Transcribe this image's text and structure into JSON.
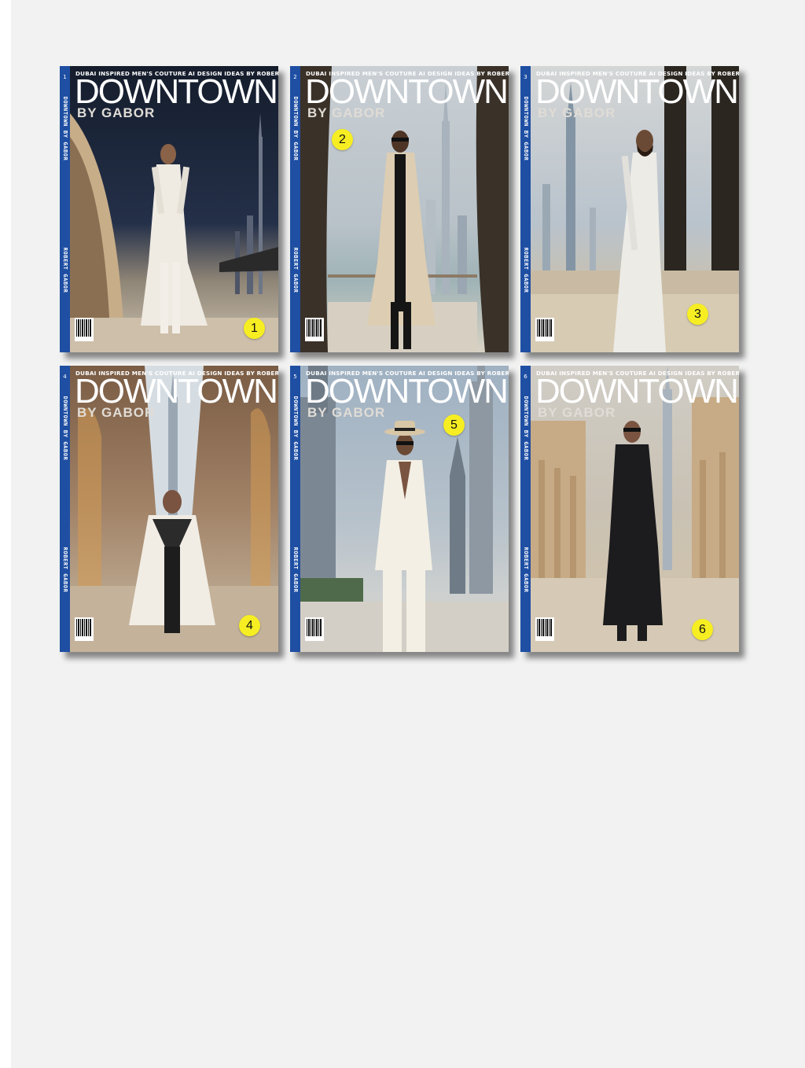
{
  "covers": [
    {
      "id": 1,
      "spine_number": "1",
      "spine_title": "DOWNTOWN BY GABOR",
      "spine_author": "ROBERT GABOR",
      "tagline": "DUBAI INSPIRED MEN'S COUTURE AI DESIGN IDEAS BY ROBERT GABOR",
      "masthead": "DOWNTOWN",
      "subhead": "BY GABOR",
      "badge": "1",
      "sky": "#1c2536",
      "ground": "#c8bca8",
      "outfit": "#efebe3"
    },
    {
      "id": 2,
      "spine_number": "2",
      "spine_title": "DOWNTOWN BY GABOR",
      "spine_author": "ROBERT GABOR",
      "tagline": "DUBAI INSPIRED MEN'S COUTURE AI DESIGN IDEAS BY ROBERT GABOR",
      "masthead": "DOWNTOWN",
      "subhead": "BY GABOR",
      "badge": "2",
      "sky": "#c6cdd3",
      "ground": "#d8d2c4",
      "outfit": "#ddcdb2"
    },
    {
      "id": 3,
      "spine_number": "3",
      "spine_title": "DOWNTOWN BY GABOR",
      "spine_author": "ROBERT GABOR",
      "tagline": "DUBAI INSPIRED MEN'S COUTURE AI DESIGN IDEAS BY ROBERT GABOR",
      "masthead": "DOWNTOWN",
      "subhead": "BY GABOR",
      "badge": "3",
      "sky": "#b9c3cc",
      "ground": "#d7cbb4",
      "outfit": "#ecebe6"
    },
    {
      "id": 4,
      "spine_number": "4",
      "spine_title": "DOWNTOWN BY GABOR",
      "spine_author": "ROBERT GABOR",
      "tagline": "DUBAI INSPIRED MEN'S COUTURE AI DESIGN IDEAS BY ROBERT GABOR",
      "masthead": "DOWNTOWN",
      "subhead": "BY GABOR",
      "badge": "4",
      "sky": "#a28368",
      "ground": "#c9b8a0",
      "outfit": "#f1ede4"
    },
    {
      "id": 5,
      "spine_number": "5",
      "spine_title": "DOWNTOWN BY GABOR",
      "spine_author": "ROBERT GABOR",
      "tagline": "DUBAI INSPIRED MEN'S COUTURE AI DESIGN IDEAS BY ROBERT GABOR",
      "masthead": "DOWNTOWN",
      "subhead": "BY GABOR",
      "badge": "5",
      "sky": "#9fb1c2",
      "ground": "#d6d2ca",
      "outfit": "#f3efe4"
    },
    {
      "id": 6,
      "spine_number": "6",
      "spine_title": "DOWNTOWN BY GABOR",
      "spine_author": "ROBERT GABOR",
      "tagline": "DUBAI INSPIRED MEN'S COUTURE AI DESIGN IDEAS BY ROBERT GABOR",
      "masthead": "DOWNTOWN",
      "subhead": "BY GABOR",
      "badge": "6",
      "sky": "#c9c1b3",
      "ground": "#d8cdbb",
      "outfit": "#1c1c1e"
    }
  ]
}
